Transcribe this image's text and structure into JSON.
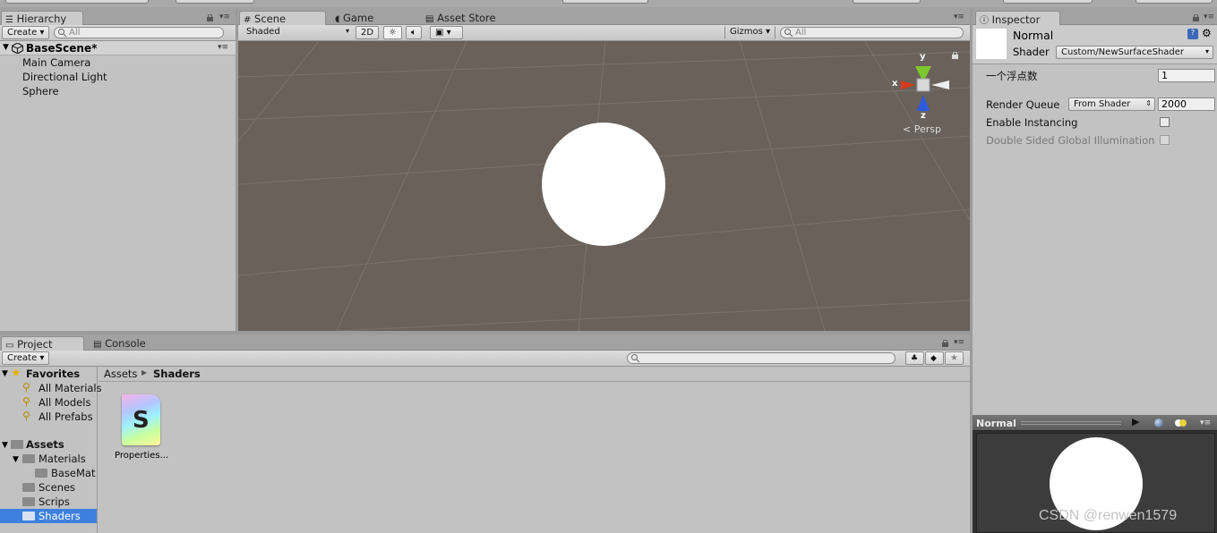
{
  "hierarchy": {
    "tab_label": "Hierarchy",
    "create_label": "Create",
    "search_placeholder": "All",
    "scene_name": "BaseScene*",
    "items": [
      "Main Camera",
      "Directional Light",
      "Sphere"
    ]
  },
  "scene_view": {
    "tabs": [
      "Scene",
      "Game",
      "Asset Store"
    ],
    "shading_mode": "Shaded",
    "btn_2d": "2D",
    "gizmos_label": "Gizmos",
    "search_placeholder": "All",
    "gizmo": {
      "x_label": "x",
      "y_label": "y",
      "z_label": "z",
      "projection": "Persp"
    }
  },
  "inspector": {
    "tab_label": "Inspector",
    "material_name": "Normal",
    "shader_label": "Shader",
    "shader_value": "Custom/NewSurfaceShader",
    "float_label": "一个浮点数",
    "float_value": "1",
    "render_queue_label": "Render Queue",
    "render_queue_mode": "From Shader",
    "render_queue_value": "2000",
    "enable_instancing_label": "Enable Instancing",
    "enable_instancing": false,
    "double_sided_label": "Double Sided Global Illumination",
    "double_sided": false,
    "preview_label": "Normal"
  },
  "project": {
    "tabs": [
      "Project",
      "Console"
    ],
    "create_label": "Create",
    "favorites_label": "Favorites",
    "favorites": [
      "All Materials",
      "All Models",
      "All Prefabs"
    ],
    "assets_label": "Assets",
    "folders": [
      "Materials",
      "BaseMat",
      "Scenes",
      "Scrips",
      "Shaders"
    ],
    "selected_folder": "Shaders",
    "breadcrumb": [
      "Assets",
      "Shaders"
    ],
    "files": [
      {
        "name": "Properties...",
        "icon": "shader-file-icon",
        "letter": "S"
      }
    ]
  },
  "watermark": "CSDN @renwen1579",
  "colors": {
    "scene_bg": "#69615a",
    "panel_bg": "#c2c2c2",
    "selection": "#3d80df",
    "axis_x": "#d73a1a",
    "axis_y": "#7cc82c",
    "axis_z": "#2d5be0"
  }
}
